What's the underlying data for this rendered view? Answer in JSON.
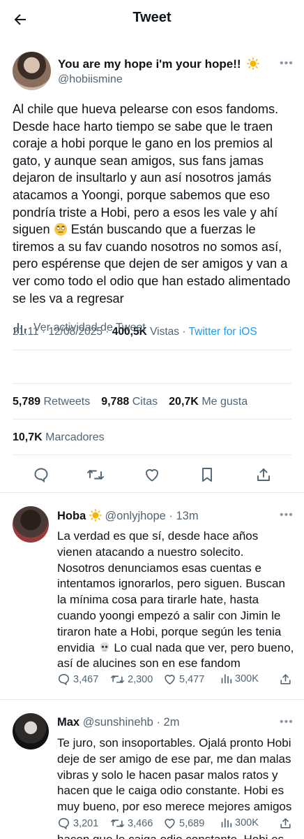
{
  "header": {
    "title": "Tweet"
  },
  "tweet": {
    "author_name": "You are my hope i'm your hope!!",
    "author_handle": "@hobiismine",
    "text_before_emoji": "Al chile que hueva pelearse con esos fandoms. Desde hace harto tiempo se sabe que le traen coraje a hobi porque le gano en los premios al gato, y aunque sean amigos, sus fans jamas dejaron de insultarlo y aun así nosotros jamás atacamos a Yoongi, porque sabemos que eso pondría triste a Hobi, pero a esos les vale y ahí siguen",
    "text_after_emoji": " Están buscando que a fuerzas le tiremos a su fav cuando nosotros no somos así, pero espérense que dejen de ser amigos y van a ver como todo el odio que han estado alimentado se les va a regresar",
    "time": "21:11",
    "date": "12/08/2025",
    "views": "400,5K",
    "views_label": "Vistas",
    "source": "Twitter for iOS",
    "activity_label": "Ver actividad de Tweet",
    "retweets": "5,789",
    "retweets_label": "Retweets",
    "quotes": "9,788",
    "quotes_label": "Citas",
    "likes": "20,7K",
    "likes_label": "Me gusta",
    "bookmarks": "10,7K",
    "bookmarks_label": "Marcadores"
  },
  "replies": [
    {
      "name": "Hoba",
      "handle": "@onlyjhope",
      "time": "13m",
      "text_before_emoji": "La verdad es que sí, desde hace años vienen atacando a nuestro solecito. Nosotros denunciamos esas cuentas e intentamos ignorarlos, pero siguen. Buscan la mínima cosa para tirarle hate, hasta cuando yoongi empezó a salir con Jimin le tiraron hate a Hobi, porque según les tenia envidia",
      "text_after_emoji": " Lo cual nada que ver, pero bueno, así de alucines son en ese fandom",
      "replies": "3,467",
      "retweets": "2,300",
      "likes": "5,477",
      "views": "300K"
    },
    {
      "name": "Max",
      "handle": "@sunshinehb",
      "time": "2m",
      "text": "Te juro, son insoportables. Ojalá pronto Hobi deje de ser amigo de ese par, me dan malas vibras y solo le hacen pasar malos ratos y hacen que le caiga odio constante. Hobi es muy bueno, por eso merece mejores amigos",
      "replies": "3,201",
      "retweets": "3,466",
      "likes": "5,689",
      "views": "300K",
      "cut_off_line": "hacen que le caiga odio constante. Hobi es"
    }
  ],
  "icons": {
    "back": "arrow-left-icon",
    "more": "more-horizontal-icon",
    "reply": "speech-bubble-icon",
    "retweet": "retweet-icon",
    "like": "heart-icon",
    "bookmark": "bookmark-icon",
    "share": "share-icon",
    "analytics": "bar-chart-icon",
    "sun_emoji": "sun-emoji",
    "eyeroll_emoji": "eye-roll-emoji",
    "skull_emoji": "skull-emoji"
  },
  "colors": {
    "accent": "#1d9bf0",
    "muted": "#536471",
    "text": "#0f1419",
    "divider": "#e7e9ea"
  }
}
